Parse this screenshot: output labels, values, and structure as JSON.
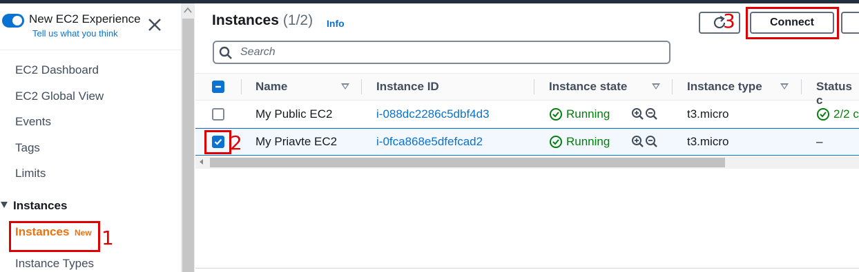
{
  "sidebar": {
    "experience_title": "New EC2 Experience",
    "experience_link": "Tell us what you think",
    "items": [
      {
        "label": "EC2 Dashboard"
      },
      {
        "label": "EC2 Global View"
      },
      {
        "label": "Events"
      },
      {
        "label": "Tags"
      },
      {
        "label": "Limits"
      }
    ],
    "section_header": "Instances",
    "active_item": {
      "label": "Instances",
      "badge": "New"
    },
    "next_item": "Instance Types"
  },
  "annotations": [
    "1",
    "2",
    "3"
  ],
  "header": {
    "title": "Instances",
    "count": "(1/2)",
    "info": "Info",
    "connect_label": "Connect"
  },
  "search": {
    "placeholder": "Search"
  },
  "table": {
    "columns": [
      "Name",
      "Instance ID",
      "Instance state",
      "Instance type",
      "Status c"
    ],
    "rows": [
      {
        "name": "My Public EC2",
        "id": "i-088dc2286c5dbf4d3",
        "state": "Running",
        "type": "t3.micro",
        "status": "2/2 c",
        "selected": false
      },
      {
        "name": "My Priavte EC2",
        "id": "i-0fca868e5dfefcad2",
        "state": "Running",
        "type": "t3.micro",
        "status": "–",
        "selected": true
      }
    ]
  },
  "colors": {
    "accent": "#0972d3",
    "active_nav": "#ec7211",
    "running": "#037f0c",
    "annotation": "#e00000"
  },
  "icons": [
    "toggle-icon",
    "close-icon",
    "refresh-icon",
    "search-icon",
    "check-circle-icon",
    "zoom-in-icon",
    "zoom-out-icon",
    "sort-icon"
  ]
}
